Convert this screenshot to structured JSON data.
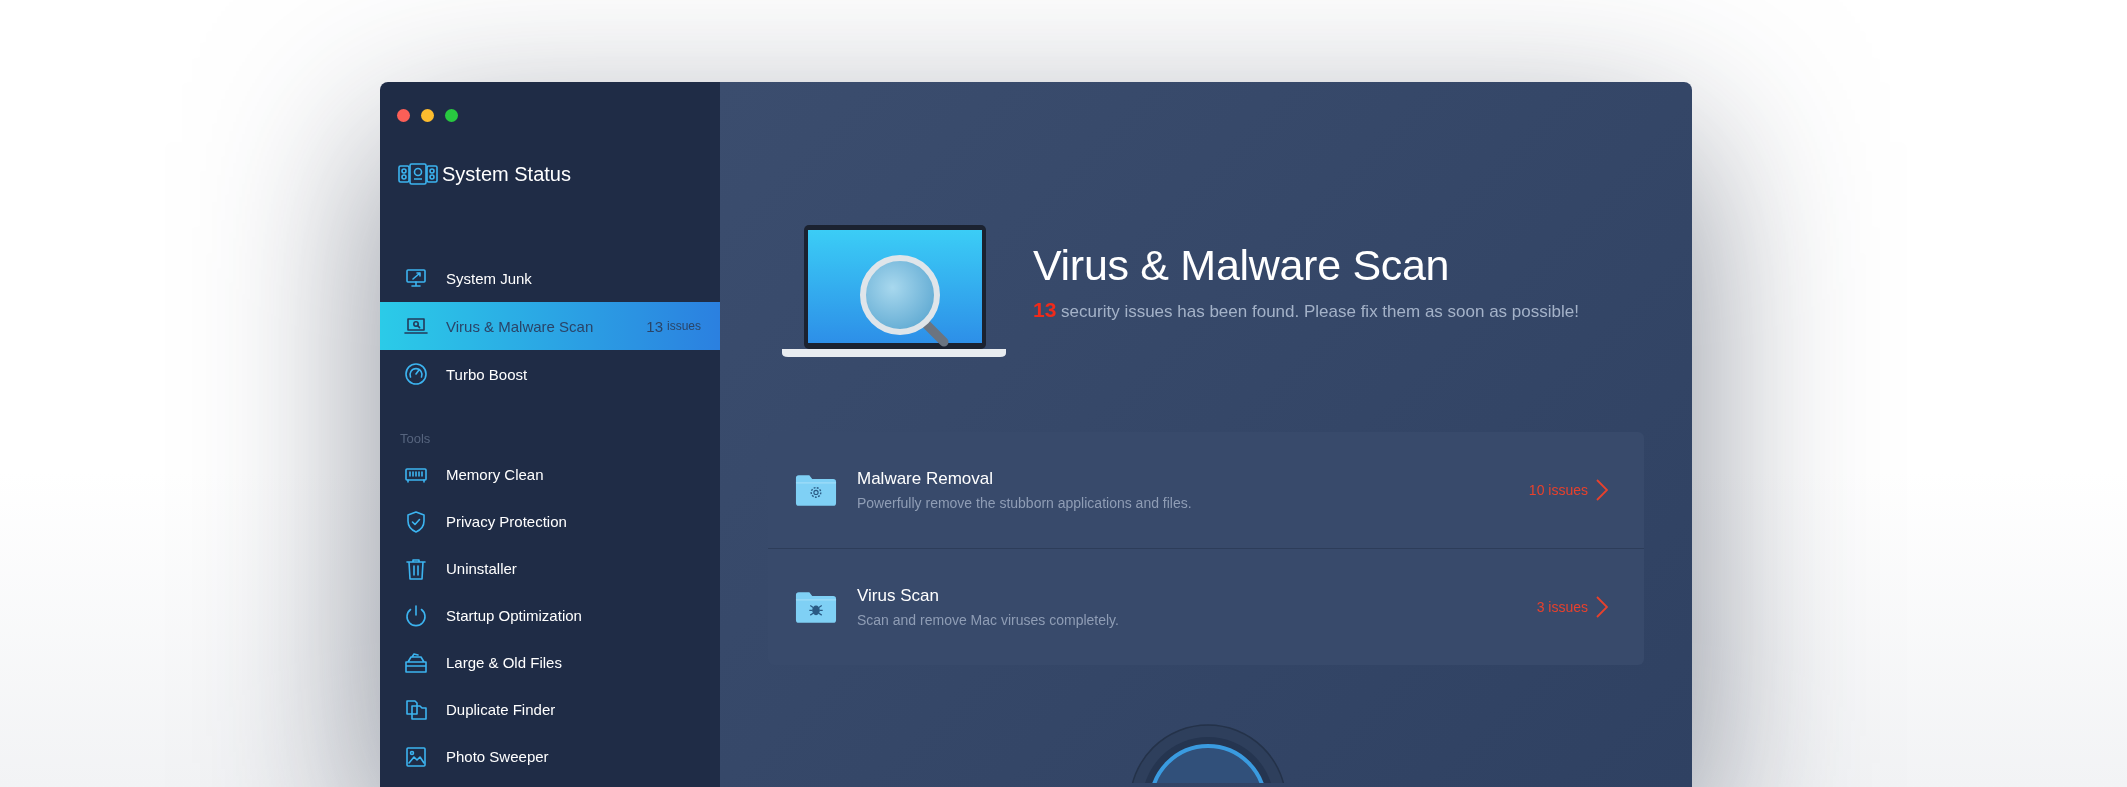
{
  "window": {
    "controls": [
      {
        "kind": "close"
      },
      {
        "kind": "minimize"
      },
      {
        "kind": "zoom"
      }
    ]
  },
  "sidebar": {
    "header": "System Status",
    "items": [
      {
        "label": "System Junk",
        "selected": false
      },
      {
        "label": "Virus & Malware Scan",
        "selected": true,
        "badge_count": "13",
        "badge_unit": "issues"
      },
      {
        "label": "Turbo Boost",
        "selected": false
      }
    ],
    "section_label": "Tools",
    "tools": [
      {
        "label": "Memory Clean",
        "selected": false
      },
      {
        "label": "Privacy Protection",
        "selected": false
      },
      {
        "label": "Uninstaller",
        "selected": false
      },
      {
        "label": "Startup Optimization",
        "selected": false
      },
      {
        "label": "Large & Old Files",
        "selected": false
      },
      {
        "label": "Duplicate Finder",
        "selected": false
      },
      {
        "label": "Photo Sweeper",
        "selected": false
      }
    ]
  },
  "main": {
    "title": "Virus & Malware Scan",
    "summary": {
      "count": "13",
      "text": "security issues has been found. Please fix them as soon as possible!"
    },
    "results": [
      {
        "title": "Malware Removal",
        "description": "Powerfully remove the stubborn applications and files.",
        "issues": "10 issues"
      },
      {
        "title": "Virus Scan",
        "description": "Scan and remove Mac viruses completely.",
        "issues": "3 issues"
      }
    ]
  }
}
